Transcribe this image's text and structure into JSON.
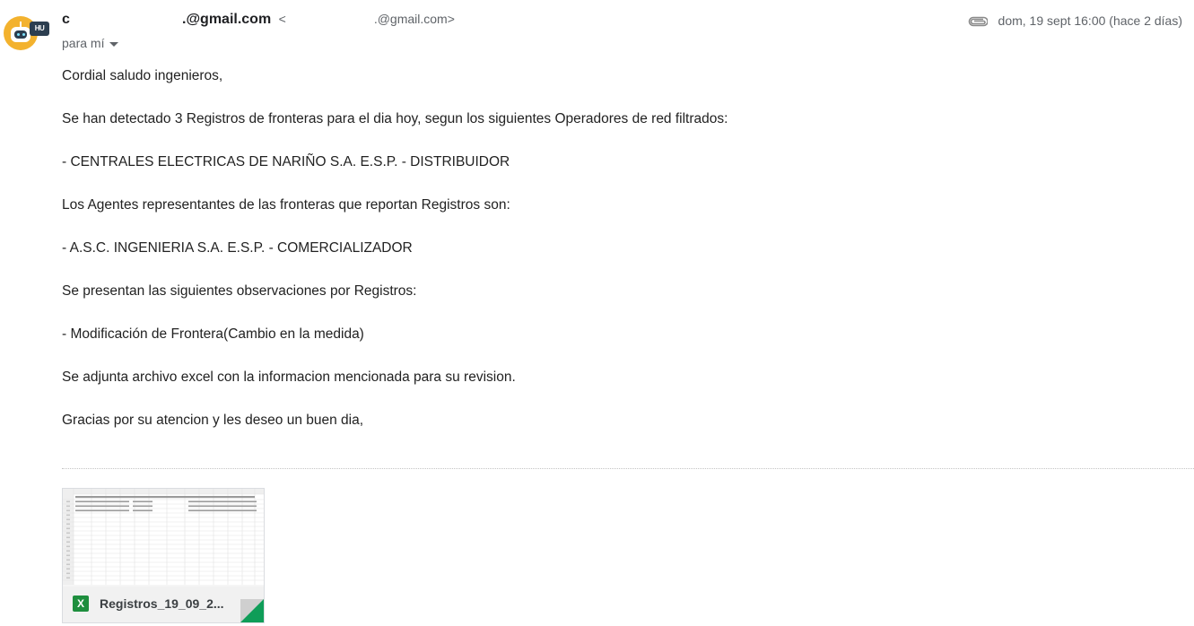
{
  "header": {
    "sender_name_suffix": ".@gmail.com",
    "sender_email_open": "<",
    "sender_email_suffix": ".@gmail.com>",
    "recipient_label": "para mí",
    "date": "dom, 19 sept 16:00 (hace 2 días)",
    "avatar_badge": "HU"
  },
  "body": {
    "lines": [
      "Cordial saludo ingenieros,",
      "Se han detectado 3 Registros de fronteras para el dia hoy, segun los siguientes Operadores de red filtrados:",
      "- CENTRALES ELECTRICAS DE NARIÑO S.A. E.S.P. - DISTRIBUIDOR",
      "Los Agentes representantes de las fronteras que reportan Registros son:",
      "- A.S.C. INGENIERIA S.A. E.S.P. - COMERCIALIZADOR",
      "Se presentan las siguientes observaciones por Registros:",
      "- Modificación de Frontera(Cambio en la medida)",
      "Se adjunta archivo excel con la informacion mencionada para su revision.",
      "Gracias por su atencion y les deseo un buen dia,"
    ]
  },
  "attachment": {
    "file_name": "Registros_19_09_2...",
    "icon": "excel-icon",
    "icon_letter": "X"
  },
  "colors": {
    "avatar": "#f3b22e",
    "excel_green": "#1e8e3e",
    "muted_text": "#5f6368"
  }
}
